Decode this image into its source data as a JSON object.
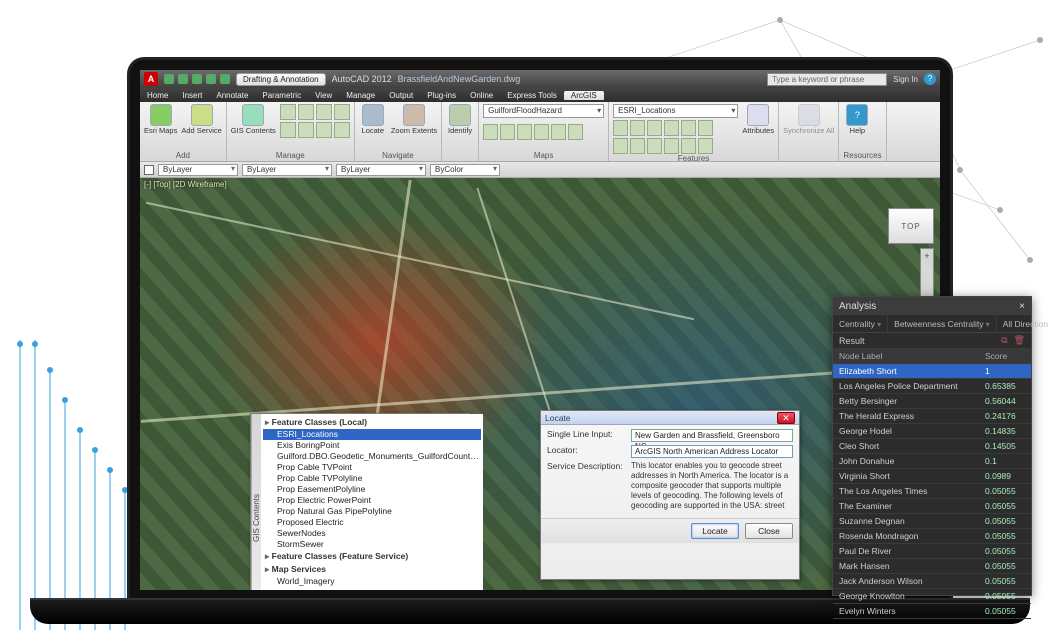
{
  "titlebar": {
    "app_initial": "A",
    "mode_label": "Drafting & Annotation",
    "app_title": "AutoCAD 2012",
    "doc_title": "BrassfieldAndNewGarden.dwg",
    "search_placeholder": "Type a keyword or phrase",
    "signin_label": "Sign In",
    "help_glyph": "?"
  },
  "menubar": {
    "items": [
      "Home",
      "Insert",
      "Annotate",
      "Parametric",
      "View",
      "Manage",
      "Output",
      "Plug-ins",
      "Online",
      "Express Tools",
      "ArcGIS"
    ],
    "active_index": 10
  },
  "ribbon": {
    "groups": {
      "add": {
        "label": "Add",
        "buttons": [
          "Esri Maps",
          "Add Service"
        ]
      },
      "manage": {
        "label": "Manage",
        "buttons": [
          "GIS Contents"
        ]
      },
      "navigate": {
        "label": "Navigate",
        "buttons": [
          "Locate",
          "Zoom Extents"
        ]
      },
      "identify": {
        "label": "",
        "buttons": [
          "Identify"
        ]
      },
      "maps": {
        "label": "Maps",
        "dropdown": "GuilfordFloodHazard"
      },
      "features": {
        "label": "Features",
        "dropdown": "ESRI_Locations",
        "attr_btn": "Attributes"
      },
      "sync": {
        "label": "",
        "buttons": [
          "Synchronize All"
        ]
      },
      "resources": {
        "label": "Resources",
        "buttons": [
          "Help"
        ]
      }
    }
  },
  "propsbar": {
    "layer": "ByLayer",
    "lw": "ByLayer",
    "lt": "ByLayer",
    "color": "ByColor"
  },
  "canvas": {
    "overlay_label": "[-] [Top] [2D Wireframe]",
    "navcube_face": "TOP",
    "zoom_plus": "+",
    "zoom_minus": "−",
    "zoom_home": "⌂"
  },
  "gis_panel": {
    "side_tab": "GIS Contents",
    "groups": {
      "g0": "Feature Classes (Local)",
      "g1": "Feature Classes (Feature Service)",
      "g2": "Map Services"
    },
    "items_local": [
      "ESRI_Locations",
      "Exis BoringPoint",
      "Guilford.DBO.Geodetic_Monuments_GuilfordCount…",
      "Prop Cable TVPoint",
      "Prop Cable TVPolyline",
      "Prop EasementPolyline",
      "Prop Electric PowerPoint",
      "Prop Natural Gas PipePolyline",
      "Proposed Electric",
      "SewerNodes",
      "StormSewer"
    ],
    "items_mapservices": [
      "World_Imagery"
    ]
  },
  "locate_panel": {
    "title": "Locate",
    "labels": {
      "input": "Single Line Input:",
      "locator": "Locator:",
      "desc": "Service Description:"
    },
    "input_value": "New Garden and Brassfield, Greensboro NC",
    "locator_value": "ArcGIS North American Address Locator",
    "desc_text": "This locator enables you to geocode street addresses in North America. The locator is a composite geocoder that supports multiple levels of geocoding. The following levels of geocoding are supported in the USA: street",
    "btn_locate": "Locate",
    "btn_close": "Close"
  },
  "analysis": {
    "title": "Analysis",
    "close_glyph": "×",
    "tabs": [
      "Centrality",
      "Betweenness Centrality",
      "All Directions"
    ],
    "subtitle": "Result",
    "icon_copy": "⧉",
    "icon_delete": "🗑",
    "col_node": "Node Label",
    "col_score": "Score",
    "rows": [
      {
        "label": "Elizabeth Short",
        "score": "1",
        "sel": true
      },
      {
        "label": "Los Angeles Police Department",
        "score": "0.65385"
      },
      {
        "label": "Betty Bersinger",
        "score": "0.56044"
      },
      {
        "label": "The Herald Express",
        "score": "0.24176"
      },
      {
        "label": "George Hodel",
        "score": "0.14835"
      },
      {
        "label": "Cleo Short",
        "score": "0.14505"
      },
      {
        "label": "John Donahue",
        "score": "0.1"
      },
      {
        "label": "Virginia Short",
        "score": "0.0989"
      },
      {
        "label": "The Los Angeles Times",
        "score": "0.05055"
      },
      {
        "label": "The Examiner",
        "score": "0.05055"
      },
      {
        "label": "Suzanne Degnan",
        "score": "0.05055"
      },
      {
        "label": "Rosenda Mondragon",
        "score": "0.05055"
      },
      {
        "label": "Paul De River",
        "score": "0.05055"
      },
      {
        "label": "Mark Hansen",
        "score": "0.05055"
      },
      {
        "label": "Jack Anderson Wilson",
        "score": "0.05055"
      },
      {
        "label": "George Knowlton",
        "score": "0.05055"
      },
      {
        "label": "Evelyn Winters",
        "score": "0.05055"
      }
    ]
  }
}
